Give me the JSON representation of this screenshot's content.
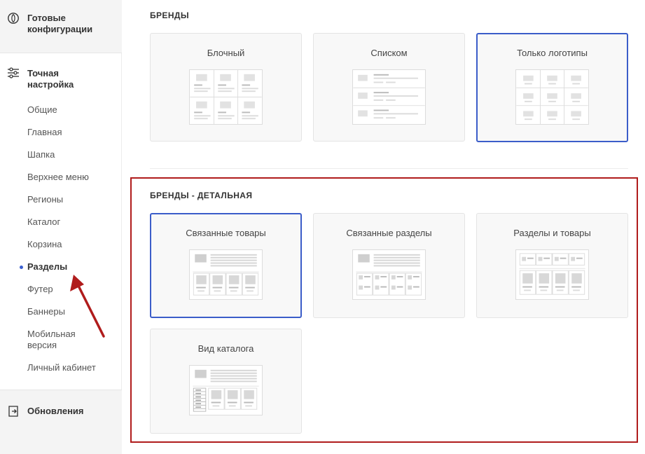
{
  "sidebar": {
    "ready_configs": "Готовые конфигурации",
    "fine_tuning": "Точная настройка",
    "items": [
      {
        "label": "Общие"
      },
      {
        "label": "Главная"
      },
      {
        "label": "Шапка"
      },
      {
        "label": "Верхнее меню"
      },
      {
        "label": "Регионы"
      },
      {
        "label": "Каталог"
      },
      {
        "label": "Корзина"
      },
      {
        "label": "Разделы",
        "active": true
      },
      {
        "label": "Футер"
      },
      {
        "label": "Баннеры"
      },
      {
        "label": "Мобильная версия"
      },
      {
        "label": "Личный кабинет"
      }
    ],
    "updates": "Обновления"
  },
  "brands": {
    "title": "БРЕНДЫ",
    "options": [
      {
        "label": "Блочный",
        "icon": "grid-layout-icon",
        "selected": false
      },
      {
        "label": "Списком",
        "icon": "list-layout-icon",
        "selected": false
      },
      {
        "label": "Только логотипы",
        "icon": "logos-layout-icon",
        "selected": true
      }
    ]
  },
  "brands_detail": {
    "title": "БРЕНДЫ - ДЕТАЛЬНАЯ",
    "options": [
      {
        "label": "Связанные товары",
        "icon": "related-products-icon",
        "selected": true
      },
      {
        "label": "Связанные разделы",
        "icon": "related-sections-icon",
        "selected": false
      },
      {
        "label": "Разделы и товары",
        "icon": "sections-and-products-icon",
        "selected": false
      },
      {
        "label": "Вид каталога",
        "icon": "catalog-view-icon",
        "selected": false
      }
    ]
  },
  "colors": {
    "accent": "#3b5dc9",
    "highlight": "#b01c1c",
    "arrow": "#b01c1c"
  }
}
